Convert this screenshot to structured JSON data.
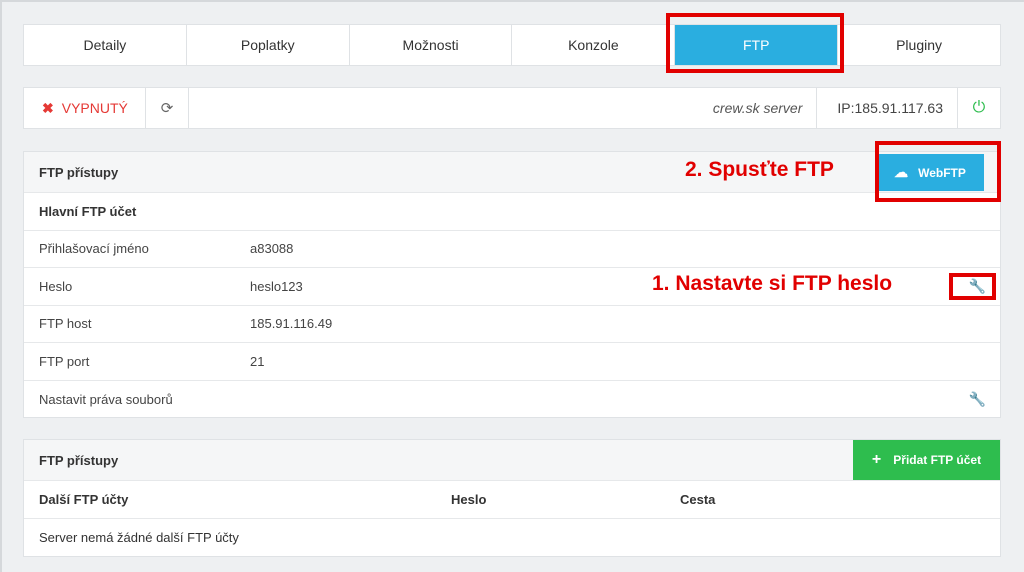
{
  "tabs": [
    {
      "label": "Detaily"
    },
    {
      "label": "Poplatky"
    },
    {
      "label": "Možnosti"
    },
    {
      "label": "Konzole"
    },
    {
      "label": "FTP"
    },
    {
      "label": "Pluginy"
    }
  ],
  "status": {
    "state": "VYPNUTÝ",
    "server_name": "crew.sk server",
    "ip": "IP:185.91.117.63"
  },
  "ftp_panel": {
    "title": "FTP přístupy",
    "webftp_label": "WebFTP",
    "section_title": "Hlavní FTP účet",
    "rows": [
      {
        "label": "Přihlašovací jméno",
        "value": "a83088"
      },
      {
        "label": "Heslo",
        "value": "heslo123"
      },
      {
        "label": "FTP host",
        "value": "185.91.116.49"
      },
      {
        "label": "FTP port",
        "value": "21"
      }
    ],
    "permissions_label": "Nastavit práva souborů"
  },
  "other_accounts": {
    "title": "FTP přístupy",
    "add_label": "Přidat FTP účet",
    "columns": [
      "Další FTP účty",
      "Heslo",
      "Cesta"
    ],
    "empty_text": "Server nemá žádné další FTP účty"
  },
  "annotations": {
    "step2": "2. Spusťte FTP",
    "step1": "1. Nastavte si FTP heslo"
  },
  "colors": {
    "accent": "#2aaee0",
    "success": "#2ebd4e",
    "danger": "#e53935",
    "annotation": "#e10000"
  }
}
